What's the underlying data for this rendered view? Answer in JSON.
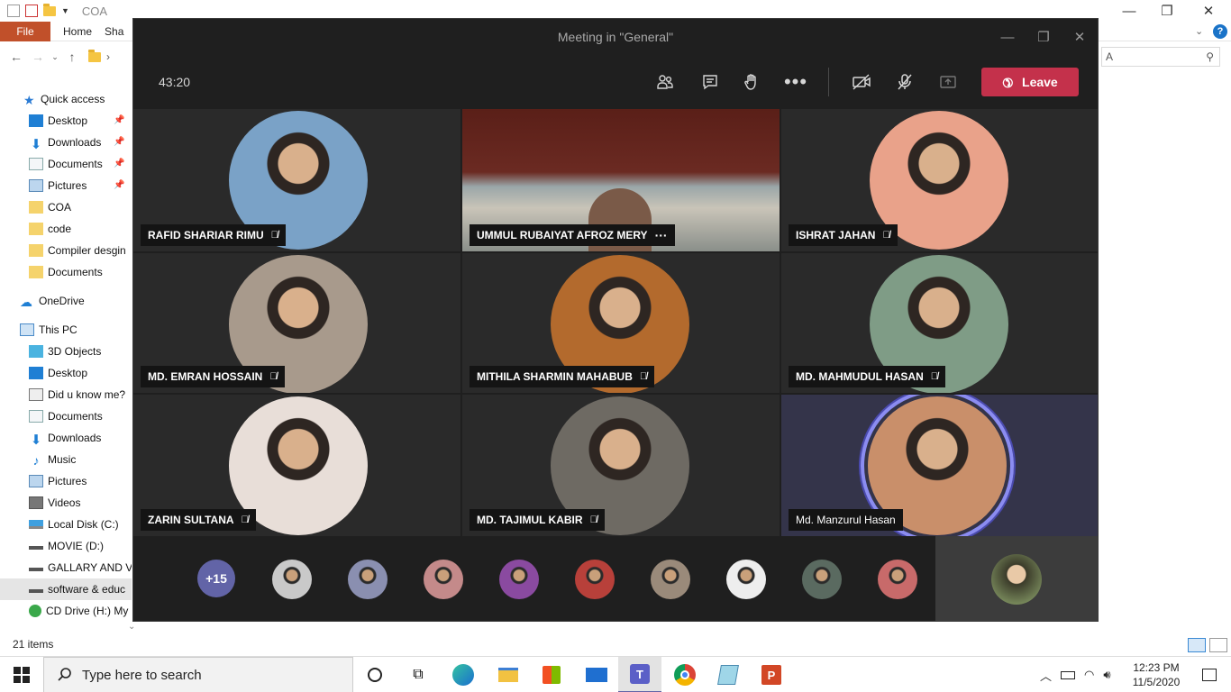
{
  "explorer": {
    "title": "COA",
    "ribbon_tabs": [
      "File",
      "Home",
      "Sha"
    ],
    "path_right": "A",
    "nav": {
      "quick_access": "Quick access",
      "quick_items": [
        "Desktop",
        "Downloads",
        "Documents",
        "Pictures",
        "COA",
        "code",
        "Compiler desgin",
        "Documents"
      ],
      "onedrive": "OneDrive",
      "this_pc": "This PC",
      "pc_items": [
        "3D Objects",
        "Desktop",
        "Did u know me?",
        "Documents",
        "Downloads",
        "Music",
        "Pictures",
        "Videos",
        "Local Disk (C:)",
        "MOVIE (D:)",
        "GALLARY AND V",
        "software & educ",
        "CD Drive (H:) My"
      ]
    },
    "status": "21 items"
  },
  "teams": {
    "title": "Meeting in \"General\"",
    "timer": "43:20",
    "leave_label": "Leave",
    "participants": [
      {
        "name": "RAFID SHARIAR RIMU",
        "muted": true,
        "color": "#7aa2c7"
      },
      {
        "name": "UMMUL RUBAIYAT AFROZ MERY",
        "muted": false,
        "more": "···",
        "color": "#7a3a30"
      },
      {
        "name": "ISHRAT JAHAN",
        "muted": true,
        "color": "#e9a28a"
      },
      {
        "name": "MD. EMRAN HOSSAIN",
        "muted": true,
        "color": "#a89a8c"
      },
      {
        "name": "MITHILA SHARMIN MAHABUB",
        "muted": true,
        "color": "#b36a2d"
      },
      {
        "name": "MD. MAHMUDUL HASAN",
        "muted": true,
        "color": "#7f9c86"
      },
      {
        "name": "ZARIN SULTANA",
        "muted": true,
        "color": "#e8ded8"
      },
      {
        "name": "MD. TAJIMUL KABIR",
        "muted": true,
        "color": "#6e6a63"
      },
      {
        "name": "Md. Manzurul Hasan",
        "muted": false,
        "color": "#c98f6a"
      }
    ],
    "overflow_count": "+15",
    "mini_avatar_colors": [
      "#c9c9c9",
      "#8a8fb0",
      "#c48a8a",
      "#8a4aa0",
      "#b8403a",
      "#9a8a7a",
      "#eeeeee",
      "#5a6a60",
      "#c86a6a"
    ]
  },
  "taskbar": {
    "search_placeholder": "Type here to search",
    "time": "12:23 PM",
    "date": "11/5/2020"
  }
}
